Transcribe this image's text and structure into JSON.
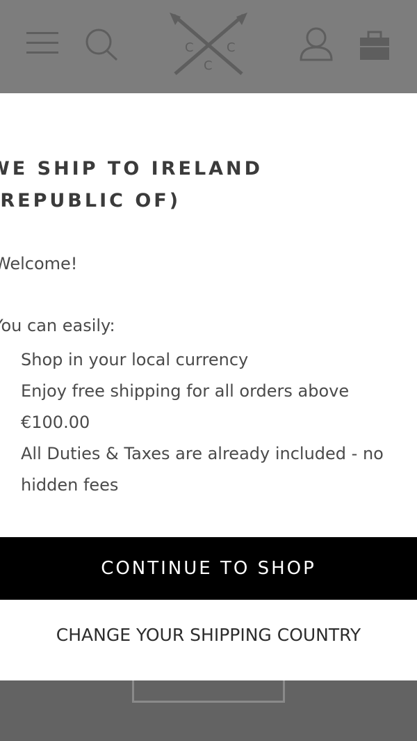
{
  "header": {
    "logo_letters": [
      "C",
      "C",
      "C"
    ]
  },
  "modal": {
    "title": "WE SHIP TO IRELAND (REPUBLIC OF)",
    "welcome": "Welcome!",
    "intro": "You can easily:",
    "benefits": [
      "Shop in your local currency",
      "Enjoy free shipping for all orders above €100.00",
      "All Duties & Taxes are already included - no hidden fees"
    ],
    "continue_label": "CONTINUE TO SHOP",
    "change_country_label": "CHANGE YOUR SHIPPING COUNTRY"
  }
}
